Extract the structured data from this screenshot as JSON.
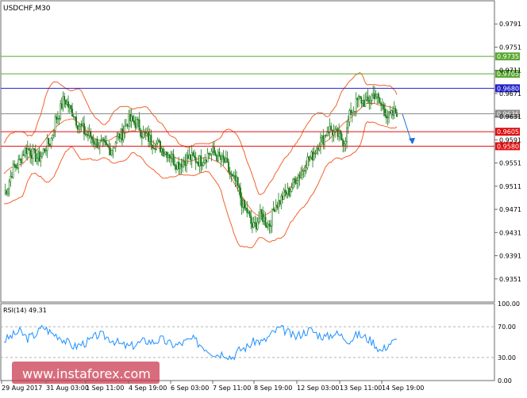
{
  "chart_data": [
    {
      "type": "candlestick",
      "title": "USDCHF,M30",
      "symbol": "USDCHF",
      "timeframe": "M30",
      "ylim": [
        0.9311,
        0.9831
      ],
      "y_ticks": [
        "0.9791",
        "0.9751",
        "0.9711",
        "0.9671",
        "0.9631",
        "0.9591",
        "0.9551",
        "0.9511",
        "0.9471",
        "0.9431",
        "0.9391",
        "0.9351"
      ],
      "x_ticks": [
        "29 Aug 2017",
        "31 Aug 03:00",
        "1 Sep 11:00",
        "4 Sep 19:00",
        "6 Sep 03:00",
        "7 Sep 11:00",
        "8 Sep 19:00",
        "12 Sep 03:00",
        "13 Sep 11:00",
        "14 Sep 19:00"
      ],
      "price_curve": [
        [
          0,
          0.95
        ],
        [
          3,
          0.9545
        ],
        [
          6,
          0.9575
        ],
        [
          9,
          0.956
        ],
        [
          12,
          0.9585
        ],
        [
          14,
          0.963
        ],
        [
          16,
          0.966
        ],
        [
          18,
          0.964
        ],
        [
          20,
          0.9615
        ],
        [
          22,
          0.96
        ],
        [
          25,
          0.9585
        ],
        [
          28,
          0.9575
        ],
        [
          31,
          0.96
        ],
        [
          33,
          0.9625
        ],
        [
          35,
          0.962
        ],
        [
          37,
          0.96
        ],
        [
          40,
          0.9585
        ],
        [
          43,
          0.957
        ],
        [
          46,
          0.955
        ],
        [
          49,
          0.956
        ],
        [
          52,
          0.9555
        ],
        [
          55,
          0.957
        ],
        [
          58,
          0.9555
        ],
        [
          61,
          0.952
        ],
        [
          64,
          0.947
        ],
        [
          66,
          0.944
        ],
        [
          68,
          0.946
        ],
        [
          70,
          0.9445
        ],
        [
          72,
          0.948
        ],
        [
          75,
          0.95
        ],
        [
          78,
          0.953
        ],
        [
          81,
          0.956
        ],
        [
          84,
          0.959
        ],
        [
          86,
          0.961
        ],
        [
          88,
          0.96
        ],
        [
          90,
          0.959
        ],
        [
          92,
          0.964
        ],
        [
          94,
          0.966
        ],
        [
          96,
          0.9655
        ],
        [
          98,
          0.967
        ],
        [
          100,
          0.965
        ],
        [
          102,
          0.963
        ],
        [
          104,
          0.964
        ]
      ],
      "levels": [
        {
          "label": "0.9735",
          "value": 0.9735,
          "color": "#5aa832"
        },
        {
          "label": "0.9705",
          "value": 0.9705,
          "color": "#5aa832"
        },
        {
          "label": "0.9680",
          "value": 0.968,
          "color": "#2222cc"
        },
        {
          "label": "0.9636",
          "value": 0.9636,
          "color": "#8a8a8a"
        },
        {
          "label": "0.9605",
          "value": 0.9605,
          "color": "#e01010"
        },
        {
          "label": "0.9580",
          "value": 0.958,
          "color": "#e01010"
        }
      ],
      "forecast_arrow": {
        "from": 0.9636,
        "to": 0.9585,
        "color": "#1a6fe0"
      }
    },
    {
      "type": "line",
      "title": "RSI(14) 49.31",
      "name": "RSI(14)",
      "last_value": 49.31,
      "ylim": [
        0,
        100
      ],
      "y_ticks": [
        "100.00",
        "70.00",
        "30.00",
        "0.00"
      ],
      "values": [
        52,
        58,
        64,
        55,
        60,
        70,
        62,
        58,
        50,
        44,
        48,
        52,
        60,
        57,
        52,
        46,
        44,
        48,
        52,
        50,
        54,
        48,
        46,
        50,
        54,
        47,
        40,
        34,
        36,
        30,
        40,
        44,
        52,
        50,
        60,
        68,
        64,
        56,
        62,
        66,
        60,
        56,
        62,
        58,
        52,
        60,
        56,
        50,
        38,
        48,
        52
      ],
      "color": "#1e90ff"
    }
  ],
  "watermark": "www.instaforex.com",
  "colors": {
    "candle": "#1a7a1a",
    "bands": "#f2622e",
    "grid": "#b4b4b4",
    "axis": "#6a6a6a"
  }
}
